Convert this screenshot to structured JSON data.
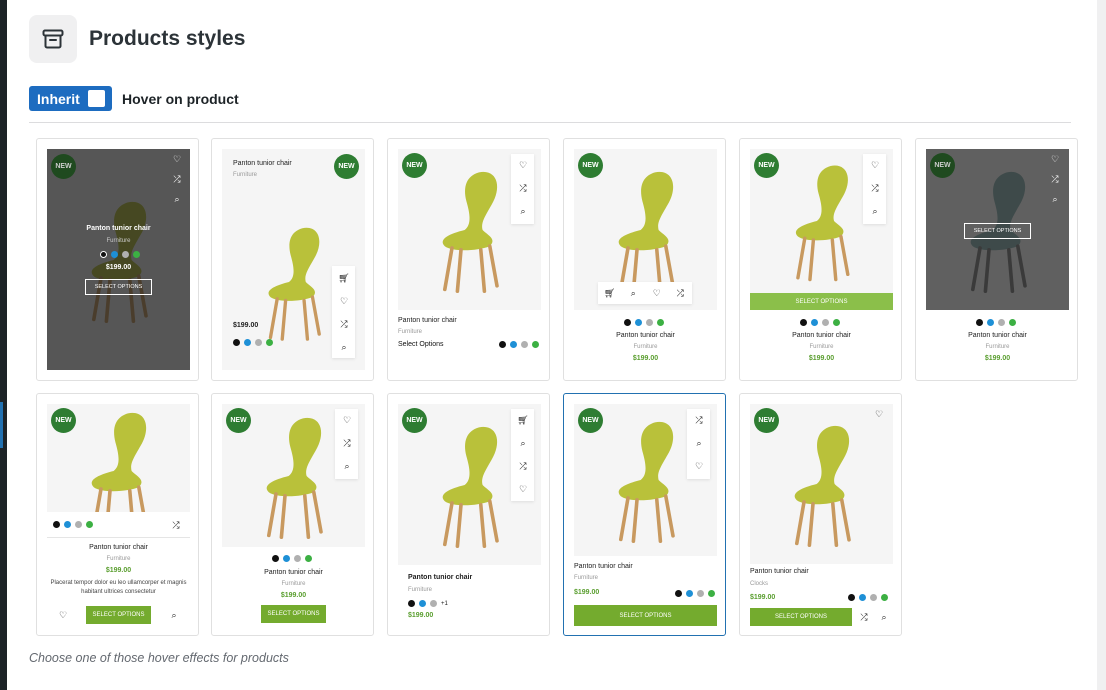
{
  "header": {
    "title": "Products styles",
    "icon": "archive-box-icon"
  },
  "toggle": {
    "label": "Inherit",
    "checked": false
  },
  "section": {
    "label": "Hover on product"
  },
  "footnote": "Choose one of those hover effects for products",
  "product": {
    "badge": "NEW",
    "name": "Panton tunior chair",
    "category": "Furniture",
    "category_alt": "Clocks",
    "price": "$199.00",
    "select_options_caps": "SELECT OPTIONS",
    "select_options": "Select Options",
    "more_colors": "+1",
    "description": "Placerat tempor dolor eu leo ullamcorper et magnis habitant ultrices consectetur"
  },
  "swatch_colors": [
    "#111111",
    "#1e90d6",
    "#b0b0b0",
    "#3cb043"
  ],
  "colors": {
    "accent": "#1d6cc0",
    "badge": "#2e7d32",
    "price": "#5a9e2f",
    "button": "#74ab2e",
    "chair": "#b9c13a"
  }
}
